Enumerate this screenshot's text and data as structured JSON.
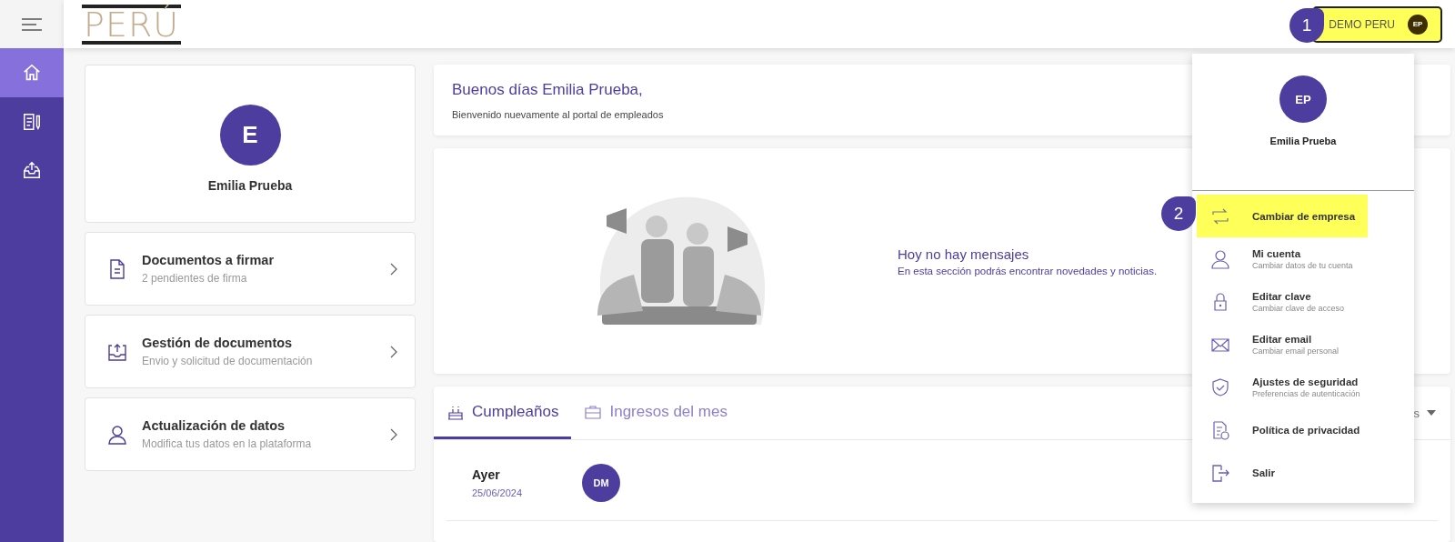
{
  "header": {
    "logo": "PERÚ",
    "account_button": {
      "label": "DEMO PERU",
      "initials": "EP",
      "highlighted": true
    }
  },
  "sidebar": {
    "items": [
      {
        "selected": true
      },
      {
        "selected": false
      },
      {
        "selected": false
      }
    ]
  },
  "profile": {
    "initial": "E",
    "name": "Emilia Prueba"
  },
  "shortcuts": [
    {
      "title": "Documentos a firmar",
      "subtitle": "2 pendientes de firma"
    },
    {
      "title": "Gestión de documentos",
      "subtitle": "Envio y solicitud de documentación"
    },
    {
      "title": "Actualización de datos",
      "subtitle": "Modifica tus datos en la plataforma"
    }
  ],
  "welcome": {
    "title": "Buenos días Emilia Prueba,",
    "subtitle": "Bienvenido nuevamente al portal de empleados"
  },
  "messages": {
    "title": "Hoy no hay mensajes",
    "subtitle": "En esta sección podrás encontrar novedades y noticias."
  },
  "tabs": [
    {
      "label": "Cumpleaños",
      "selected": true
    },
    {
      "label": "Ingresos del mes",
      "selected": false
    }
  ],
  "tab_filter": "s",
  "birthdays": [
    {
      "day": "Ayer",
      "date": "25/06/2024",
      "initials": "DM"
    }
  ],
  "user_menu": {
    "initials": "EP",
    "name": "Emilia Prueba",
    "items": [
      {
        "title": "Cambiar de empresa",
        "highlighted": true
      },
      {
        "title": "Mi cuenta",
        "subtitle": "Cambiar datos de tu cuenta",
        "highlighted": false
      },
      {
        "title": "Editar clave",
        "subtitle": "Cambiar clave de acceso",
        "highlighted": false
      },
      {
        "title": "Editar email",
        "subtitle": "Cambiar email personal",
        "highlighted": false
      },
      {
        "title": "Ajustes de seguridad",
        "subtitle": "Preferencias de autenticación",
        "highlighted": false
      },
      {
        "title": "Política de privacidad",
        "highlighted": false
      },
      {
        "title": "Salir",
        "highlighted": false
      }
    ]
  },
  "callouts": [
    {
      "label": "1"
    },
    {
      "label": "2"
    }
  ]
}
